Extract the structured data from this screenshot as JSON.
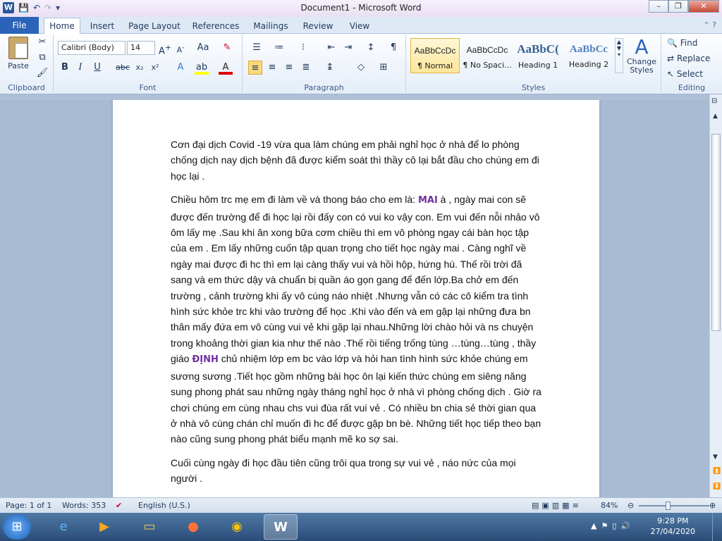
{
  "window": {
    "title": "Document1  -  Microsoft Word",
    "controls": [
      "–",
      "❐",
      "✕"
    ]
  },
  "qat": {
    "app_icon": "W",
    "save": "💾",
    "undo": "↶",
    "redo": "↷",
    "more": "▾"
  },
  "tabs": {
    "file": "File",
    "items": [
      "Home",
      "Insert",
      "Page Layout",
      "References",
      "Mailings",
      "Review",
      "View"
    ]
  },
  "ribbon": {
    "clipboard": {
      "label": "Clipboard",
      "paste": "Paste"
    },
    "font": {
      "label": "Font",
      "family": "Calibri (Body)",
      "size": "14"
    },
    "paragraph": {
      "label": "Paragraph"
    },
    "styles": {
      "label": "Styles",
      "items": [
        {
          "preview": "AaBbCcDc",
          "name": "¶ Normal"
        },
        {
          "preview": "AaBbCcDc",
          "name": "¶ No Spaci..."
        },
        {
          "preview": "AaBbC(",
          "name": "Heading 1"
        },
        {
          "preview": "AaBbCc",
          "name": "Heading 2"
        }
      ],
      "change": "Change Styles"
    },
    "editing": {
      "label": "Editing",
      "find": "Find",
      "replace": "Replace",
      "select": "Select"
    }
  },
  "document": {
    "p1": "Cơn đại dịch Covid -19 vừa qua làm chúng em phải nghỉ học ở nhà để lo phòng chống dịch nay  dịch bệnh đã được kiểm soát thì thầy cô lại bắt đầu cho chúng em đi học lại .",
    "p2a": "Chiều hôm trc mẹ em đi làm về và thong báo cho em là: ",
    "mai": "MAI",
    "p2b": " à , ngày mai con sẽ được đến trường để đi học lại rồi đấy con có vui ko vậy con. Em vui đến nỗi nhảo vô ôm lấy mẹ .Sau khi ăn xong bữa cơm chiều thì em vô phòng ngay cái bàn học tập của em . Em lấy những cuốn tập quan trọng cho tiết học ngày mai . Càng nghĩ về ngày mai được đi hc thì em lại càng thấy vui và hồi hộp, hứng hú. Thế rồi trời đã sang và em thức dậy  và chuẩn bị quần áo gọn gang để đến lớp.Ba chở em đến trường , cảnh trường khi ấy vô cúng náo nhiệt .Nhưng vẫn có các cô kiểm tra tình hình sức khỏe trc khi vào trường để học .Khi vào đến và em gặp lại những đưa bn thân mấy đứa em vô cùng vui vẻ khi gặp lại nhau.Những lời chào hỏi và ns chuyện trong khoảng thời gian kia như thế nào .Thế rồi tiếng trống tùng …tùng…tùng , thầy giáo  ",
    "dinh": "ĐỊNH",
    "p2c": " chủ nhiệm lớp em bc vào lớp và hỏi han tình hình sức khỏe chúng em sương sương .Tiết học gồm những bài học ôn lại kiến thức chúng em siêng năng sung phong phát  sau những ngày tháng nghỉ học ở nhà vì phòng chống dịch . Giờ ra chơi chúng em cùng nhau chs vui đùa rất vui vẻ . Có nhiều bn chia sẻ thời gian qua ở nhà vô cùng chán chỉ muốn đi hc để được gặp bn bè. Những tiết học tiếp theo bạn nào cũng sung phong  phát  biểu mạnh mẽ ko sợ sai.",
    "p3": "Cuối cùng ngày đi học đầu tiên cũng trôi qua trong sự vui vẻ , náo nức của mọi người ."
  },
  "status": {
    "page": "Page: 1 of 1",
    "words": "Words: 353",
    "language": "English (U.S.)",
    "zoom": "84%"
  },
  "taskbar": {
    "time": "9:28 PM",
    "date": "27/04/2020"
  }
}
